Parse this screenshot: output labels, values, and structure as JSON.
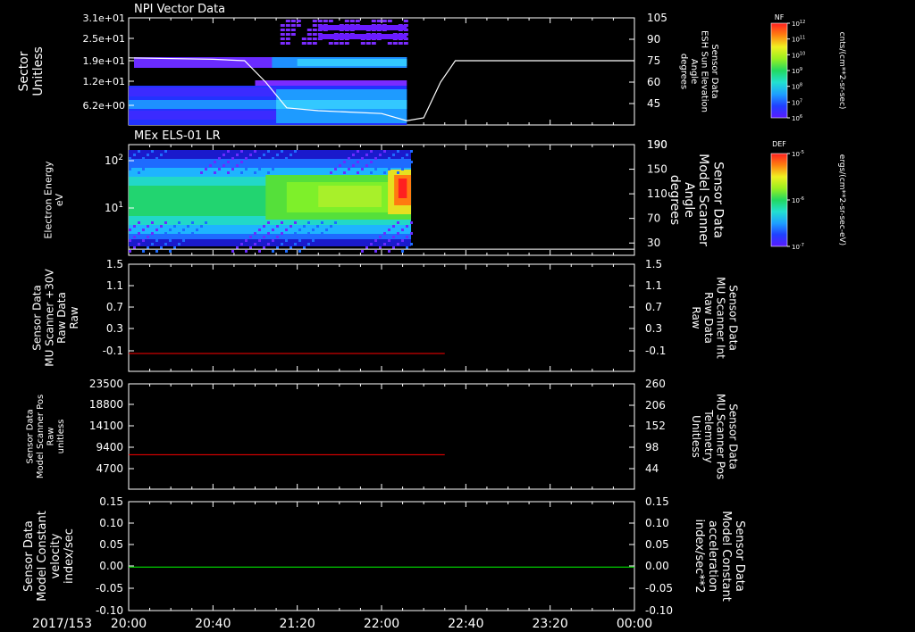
{
  "chart_data": [
    {
      "type": "heatmap",
      "title": "NPI Vector Data",
      "ylabel": "Sector\nUnitless",
      "yticks": [
        "3.1e+01",
        "2.5e+01",
        "1.9e+01",
        "1.2e+01",
        "6.2e+00"
      ],
      "right_ylabel": "Sensor Data\nESH Sun Elevation\nAngle\ndegrees",
      "right_yticks": [
        "105",
        "90",
        "75",
        "60",
        "45"
      ],
      "overlay_line": {
        "name": "ESH Sun Elevation Angle",
        "color": "#ffffff",
        "x": [
          "20:00",
          "20:40",
          "20:55",
          "21:05",
          "21:15",
          "21:30",
          "22:00",
          "22:12",
          "22:20",
          "22:28",
          "22:35",
          "23:00",
          "00:00"
        ],
        "y": [
          77,
          76,
          75,
          60,
          42,
          40,
          38,
          33,
          35,
          60,
          75,
          75,
          75
        ]
      },
      "colorbar": {
        "label": "NF",
        "units": "cnts/(cm**2-sr-sec)",
        "ticks": [
          "10^12",
          "10^11",
          "10^10",
          "10^9",
          "10^8",
          "10^7",
          "10^6"
        ]
      }
    },
    {
      "type": "heatmap",
      "title": "MEx ELS-01 LR",
      "ylabel": "Electron Energy\neV",
      "yticks": [
        "10^2",
        "10^1"
      ],
      "right_ylabel": "Sensor Data\nModel Scanner\nAngle\ndegrees",
      "right_yticks": [
        "190",
        "150",
        "110",
        "70",
        "30"
      ],
      "overlay_line": {
        "name": "Model Scanner Angle",
        "color": "#ffffff",
        "x": [
          "20:00",
          "00:00"
        ],
        "y": [
          20,
          20
        ]
      },
      "colorbar": {
        "label": "DEF",
        "units": "ergs/(cm**2-sr-sec-eV)",
        "ticks": [
          "10^-5",
          "10^-6",
          "10^-7"
        ]
      }
    },
    {
      "type": "line",
      "ylabel": "Sensor Data\nMU Scanner +30V\nRaw Data\nRaw",
      "yticks": [
        "1.5",
        "1.1",
        "0.7",
        "0.3",
        "-0.1"
      ],
      "ylim": [
        -0.3,
        1.5
      ],
      "right_ylabel": "Sensor Data\nMU Scanner Int\nRaw Data\nRaw",
      "right_ylabel_color": "#ff0000",
      "right_yticks": [
        "1.5",
        "1.1",
        "0.7",
        "0.3",
        "-0.1"
      ],
      "series": [
        {
          "color": "#ff0000",
          "x": [
            "20:00",
            "22:30"
          ],
          "values": [
            0,
            0
          ]
        }
      ]
    },
    {
      "type": "line",
      "ylabel": "Sensor Data\nModel Scanner Pos\nRaw\nunitless",
      "yticks": [
        "23500",
        "18800",
        "14100",
        "9400",
        "4700"
      ],
      "ylim": [
        0,
        23500
      ],
      "right_ylabel": "Sensor Data\nMU Scanner Pos\nTelemetry\nUnitless",
      "right_ylabel_color": "#ff0000",
      "right_yticks": [
        "260",
        "206",
        "152",
        "98",
        "44"
      ],
      "right_ylim": [
        0,
        260
      ],
      "series": [
        {
          "color": "#ff0000",
          "x": [
            "20:00",
            "22:30"
          ],
          "values": [
            85,
            85
          ],
          "axis": "right"
        }
      ]
    },
    {
      "type": "line",
      "ylabel": "Sensor Data\nModel Constant\nvelocity\nindex/sec",
      "yticks": [
        "0.15",
        "0.10",
        "0.05",
        "0.00",
        "-0.05",
        "-0.10"
      ],
      "ylim": [
        -0.1,
        0.15
      ],
      "right_ylabel": "Sensor Data\nModel Constant\nacceleration\nindex/sec**2",
      "right_ylabel_color": "#00ff00",
      "right_yticks": [
        "0.15",
        "0.10",
        "0.05",
        "0.00",
        "-0.05",
        "-0.10"
      ],
      "series": [
        {
          "color": "#00ff00",
          "x": [
            "20:00",
            "00:00"
          ],
          "values": [
            0,
            0
          ]
        }
      ]
    }
  ],
  "time_axis": {
    "date": "2017/153",
    "ticks": [
      "20:00",
      "20:40",
      "21:20",
      "22:00",
      "22:40",
      "23:20",
      "00:00"
    ]
  }
}
